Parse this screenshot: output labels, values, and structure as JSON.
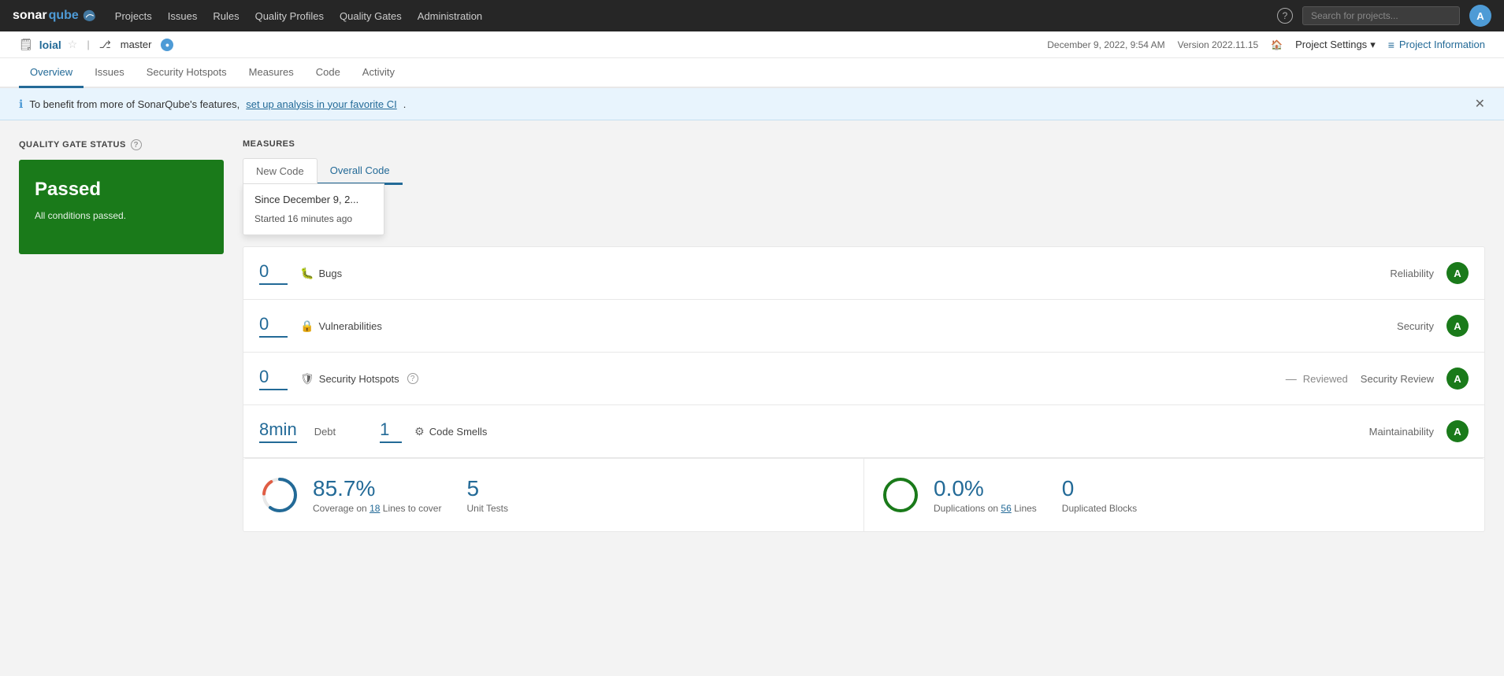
{
  "brand": {
    "sonar": "sonar",
    "qube": "qube",
    "logo_text": "sonarqube"
  },
  "topnav": {
    "links": [
      "Projects",
      "Issues",
      "Rules",
      "Quality Profiles",
      "Quality Gates",
      "Administration"
    ],
    "search_placeholder": "Search for projects...",
    "user_initial": "A"
  },
  "project": {
    "name": "loial",
    "branch": "master",
    "timestamp": "December 9, 2022, 9:54 AM",
    "version": "Version 2022.11.15",
    "settings_label": "Project Settings",
    "info_label": "Project Information"
  },
  "subnav": {
    "links": [
      "Overview",
      "Issues",
      "Security Hotspots",
      "Measures",
      "Code",
      "Activity"
    ],
    "active": "Overview"
  },
  "banner": {
    "text_before": "To benefit from more of SonarQube's features,",
    "link_text": "set up analysis in your favorite CI",
    "text_after": "."
  },
  "quality_gate": {
    "section_title": "QUALITY GATE STATUS",
    "status": "Passed",
    "subtitle": "All conditions passed."
  },
  "measures": {
    "section_title": "MEASURES",
    "tabs": [
      "New Code",
      "Overall Code"
    ],
    "active_tab": "Overall Code",
    "new_code_since": "Since December 9, 2...",
    "new_code_started": "Started 16 minutes ago"
  },
  "metrics": [
    {
      "value": "0",
      "label": "Bugs",
      "icon": "bug",
      "category": "Reliability",
      "grade": "A"
    },
    {
      "value": "0",
      "label": "Vulnerabilities",
      "icon": "lock",
      "category": "Security",
      "grade": "A"
    },
    {
      "value": "0",
      "label": "Security Hotspots",
      "icon": "shield",
      "category": "Security Review",
      "grade": "A",
      "reviewed": "Reviewed",
      "reviewed_prefix": "—"
    },
    {
      "debt": "8min",
      "debt_label": "Debt",
      "code_smells_value": "1",
      "code_smells_label": "Code Smells",
      "category": "Maintainability",
      "grade": "A"
    }
  ],
  "coverage": {
    "percentage": "85.7%",
    "coverage_label": "Coverage on",
    "lines_value": "18",
    "lines_label": "Lines to cover",
    "circle_value": 85.7,
    "circle_color": "#236a97",
    "circle_bg": "#e8e8e8"
  },
  "unit_tests": {
    "value": "5",
    "label": "Unit Tests"
  },
  "duplications": {
    "percentage": "0.0%",
    "label": "Duplications on",
    "lines_value": "56",
    "lines_label": "Lines",
    "circle_value": 0,
    "circle_color": "#1a7a1a"
  },
  "duplicated_blocks": {
    "value": "0",
    "label": "Duplicated Blocks"
  }
}
